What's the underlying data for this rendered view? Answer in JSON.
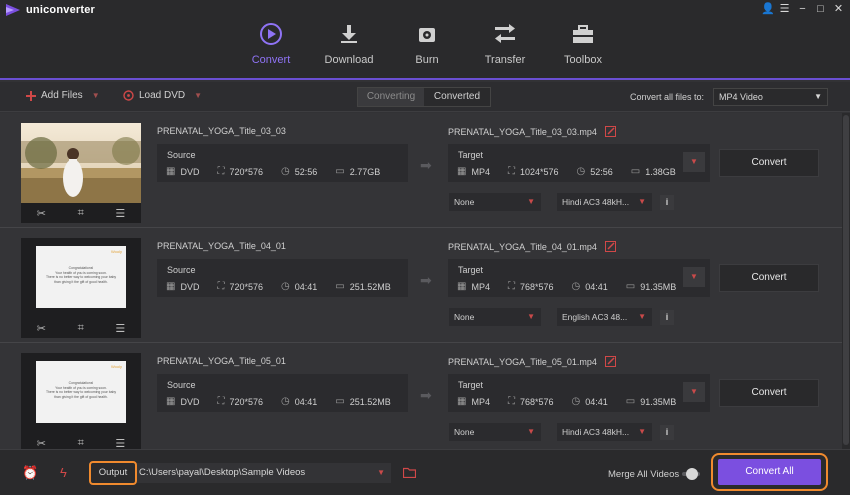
{
  "app": {
    "title": "uniconverter"
  },
  "window_controls": [
    "👤",
    "☰",
    "−",
    "□",
    "✕"
  ],
  "nav": [
    {
      "label": "Convert",
      "icon": "convert-icon",
      "active": true
    },
    {
      "label": "Download",
      "icon": "download-icon",
      "active": false
    },
    {
      "label": "Burn",
      "icon": "burn-icon",
      "active": false
    },
    {
      "label": "Transfer",
      "icon": "transfer-icon",
      "active": false
    },
    {
      "label": "Toolbox",
      "icon": "toolbox-icon",
      "active": false
    }
  ],
  "toolbar": {
    "add_files": "Add Files",
    "load_dvd": "Load DVD",
    "tab_converting": "Converting",
    "tab_converted": "Converted",
    "convert_all_to": "Convert all files to:",
    "format": "MP4 Video"
  },
  "items": [
    {
      "title": "PRENATAL_YOGA_Title_03_03",
      "source": {
        "label": "Source",
        "format": "DVD",
        "resolution": "720*576",
        "duration": "52:56",
        "size": "2.77GB"
      },
      "target_title": "PRENATAL_YOGA_Title_03_03.mp4",
      "target": {
        "label": "Target",
        "format": "MP4",
        "resolution": "1024*576",
        "duration": "52:56",
        "size": "1.38GB"
      },
      "subtitle": "None",
      "audio": "Hindi AC3 48kH...",
      "convert_label": "Convert",
      "thumb_type": "photo"
    },
    {
      "title": "PRENATAL_YOGA_Title_04_01",
      "source": {
        "label": "Source",
        "format": "DVD",
        "resolution": "720*576",
        "duration": "04:41",
        "size": "251.52MB"
      },
      "target_title": "PRENATAL_YOGA_Title_04_01.mp4",
      "target": {
        "label": "Target",
        "format": "MP4",
        "resolution": "768*576",
        "duration": "04:41",
        "size": "91.35MB"
      },
      "subtitle": "None",
      "audio": "English AC3 48...",
      "convert_label": "Convert",
      "thumb_type": "slide"
    },
    {
      "title": "PRENATAL_YOGA_Title_05_01",
      "source": {
        "label": "Source",
        "format": "DVD",
        "resolution": "720*576",
        "duration": "04:41",
        "size": "251.52MB"
      },
      "target_title": "PRENATAL_YOGA_Title_05_01.mp4",
      "target": {
        "label": "Target",
        "format": "MP4",
        "resolution": "768*576",
        "duration": "04:41",
        "size": "91.35MB"
      },
      "subtitle": "None",
      "audio": "Hindi AC3 48kH...",
      "convert_label": "Convert",
      "thumb_type": "slide"
    }
  ],
  "slide": {
    "brand": "Wooly",
    "lines": [
      "Congratulations!",
      "Your health of you is coming soon.",
      "There is no better way to welcoming your baby",
      "than giving it the gift of good health."
    ]
  },
  "bottom": {
    "output_label": "Output",
    "output_path": "C:\\Users\\payal\\Desktop\\Sample Videos",
    "merge_label": "Merge All Videos",
    "convert_all": "Convert All"
  },
  "colors": {
    "accent": "#7b4fe0",
    "highlight": "#f08a2e",
    "danger": "#c94a4a"
  }
}
